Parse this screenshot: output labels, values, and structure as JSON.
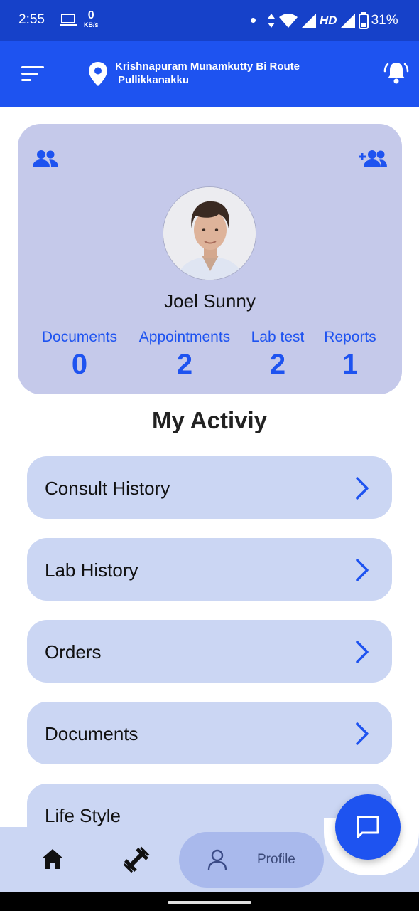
{
  "status_bar": {
    "time": "2:55",
    "net_speed_value": "0",
    "net_speed_unit": "KB/s",
    "network_label": "HD",
    "battery": "31%"
  },
  "header": {
    "location_line1": "Krishnapuram Munamkutty Bi Route",
    "location_line2": "Pullikkanakku",
    "icons": [
      "menu-icon",
      "location-pin-icon",
      "bell-icon"
    ]
  },
  "profile": {
    "name": "Joel Sunny",
    "stats": [
      {
        "label": "Documents",
        "value": "0"
      },
      {
        "label": "Appointments",
        "value": "2"
      },
      {
        "label": "Lab test",
        "value": "2"
      },
      {
        "label": "Reports",
        "value": "1"
      }
    ]
  },
  "activity": {
    "title": "My Activiy",
    "items": [
      {
        "label": "Consult History"
      },
      {
        "label": "Lab History"
      },
      {
        "label": "Orders"
      },
      {
        "label": "Documents"
      },
      {
        "label": "Life Style"
      }
    ]
  },
  "bottom_nav": {
    "profile_label": "Profile",
    "items": [
      "home-icon",
      "dumbbell-icon",
      "person-icon",
      "chat-icon"
    ]
  },
  "colors": {
    "primary": "#1e53f0",
    "status_bar": "#1641c9",
    "card": "#c5c9ea",
    "list_item": "#cbd6f3"
  }
}
